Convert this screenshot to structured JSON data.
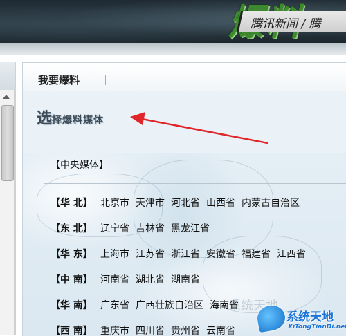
{
  "banner": {
    "logo_text": "爆料",
    "subtitle": "腾讯新闻 / 腾"
  },
  "panel": {
    "tab_title": "我要爆料",
    "section_big": "选",
    "section_rest": "择爆料媒体"
  },
  "central": {
    "label": "【中央媒体】"
  },
  "regions": [
    {
      "label": "【华 北】",
      "provinces": [
        "北京市",
        "天津市",
        "河北省",
        "山西省",
        "内蒙古自治区"
      ]
    },
    {
      "label": "【东 北】",
      "provinces": [
        "辽宁省",
        "吉林省",
        "黑龙江省"
      ]
    },
    {
      "label": "【华 东】",
      "provinces": [
        "上海市",
        "江苏省",
        "浙江省",
        "安徽省",
        "福建省",
        "江西省"
      ]
    },
    {
      "label": "【中 南】",
      "provinces": [
        "河南省",
        "湖北省",
        "湖南省"
      ]
    },
    {
      "label": "【华 南】",
      "provinces": [
        "广东省",
        "广西壮族自治区",
        "海南省"
      ]
    },
    {
      "label": "【西 南】",
      "provinces": [
        "重庆市",
        "四川省",
        "贵州省",
        "云南省"
      ]
    }
  ],
  "watermark": {
    "title": "系统天地",
    "sub": "XiTongTianDi.net",
    "faint": "系统天地"
  },
  "colors": {
    "arrow": "#e0262a",
    "panel_bg": "#eaf2f8",
    "watermark": "#1a73d6"
  }
}
